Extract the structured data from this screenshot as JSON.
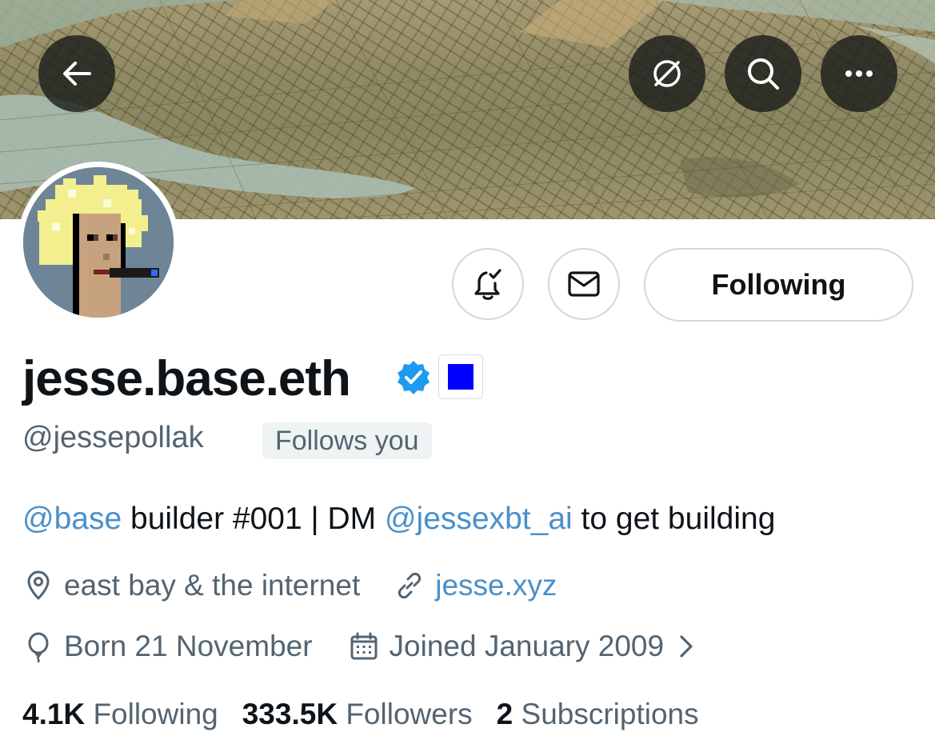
{
  "header": {
    "back_icon": "arrow-left-icon",
    "actions": [
      "stealth-icon",
      "search-icon",
      "more-icon"
    ]
  },
  "profile": {
    "display_name": "jesse.base.eth",
    "verified_badge": "verified-icon",
    "verified_color": "#1d9bf0",
    "affiliate_badge_color": "#0000ff",
    "handle": "@jessepollak",
    "follows_you": "Follows you"
  },
  "actions": {
    "notify_icon": "bell-check-icon",
    "message_icon": "envelope-icon",
    "following_label": "Following"
  },
  "bio": {
    "mention1": "@base",
    "text1": " builder #001 | DM ",
    "mention2": "@jessexbt_ai",
    "text2": " to get building"
  },
  "meta": {
    "location": "east bay & the internet",
    "website": "jesse.xyz",
    "birthday": "Born 21 November",
    "joined": "Joined January 2009"
  },
  "stats": {
    "following_count": "4.1K",
    "following_label": "Following",
    "followers_count": "333.5K",
    "followers_label": "Followers",
    "subscriptions_count": "2",
    "subscriptions_label": "Subscriptions"
  },
  "colors": {
    "text_primary": "#0f1419",
    "text_secondary": "#536471",
    "link": "#4a90c9",
    "border": "#cfd9de"
  }
}
